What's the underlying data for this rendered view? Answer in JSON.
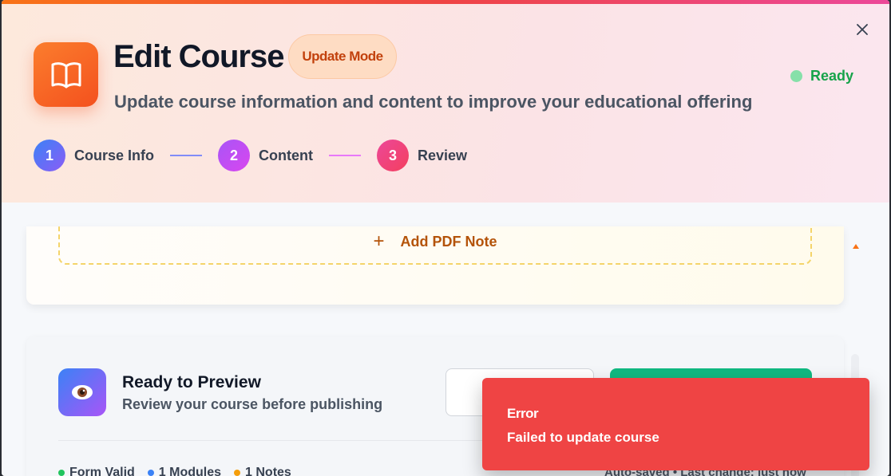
{
  "header": {
    "title": "Edit Course",
    "mode_badge": "Update Mode",
    "subtitle": "Update course information and content to improve your educational offering",
    "status": "Ready",
    "icon": "open-book-icon",
    "close_icon": "close-icon"
  },
  "steps": [
    {
      "number": "1",
      "label": "Course Info",
      "color": "#6366f1"
    },
    {
      "number": "2",
      "label": "Content",
      "color": "#c026d3"
    },
    {
      "number": "3",
      "label": "Review",
      "color": "#e11d48"
    }
  ],
  "notes_section": {
    "add_pdf_label": "Add PDF Note",
    "add_icon": "plus-icon"
  },
  "preview": {
    "title": "Ready to Preview",
    "subtitle": "Review your course before publishing",
    "icon": "eye-icon"
  },
  "footer": {
    "stats": [
      {
        "label": "Form Valid",
        "color": "#22c55e"
      },
      {
        "label": "1 Modules",
        "color": "#3b82f6"
      },
      {
        "label": "1 Notes",
        "color": "#f59e0b"
      }
    ],
    "autosave": "Auto-saved • Last change: just now"
  },
  "toast": {
    "title": "Error",
    "message": "Failed to update course",
    "color": "#ef4444"
  }
}
